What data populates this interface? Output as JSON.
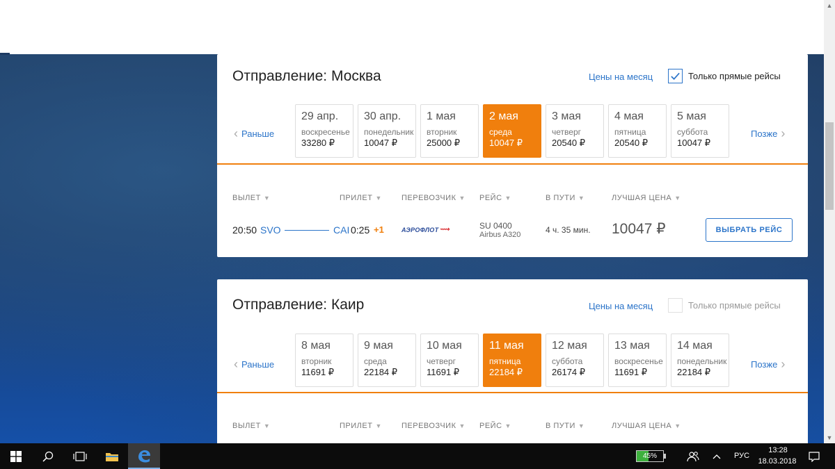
{
  "outbound": {
    "title": "Отправление: Москва",
    "month_link": "Цены на месяц",
    "direct_label": "Только прямые рейсы",
    "direct_checked": true,
    "prev_label": "Раньше",
    "next_label": "Позже",
    "dates": [
      {
        "date": "29 апр.",
        "weekday": "воскресенье",
        "price": "33280 ₽",
        "selected": false
      },
      {
        "date": "30 апр.",
        "weekday": "понедельник",
        "price": "10047 ₽",
        "selected": false
      },
      {
        "date": "1 мая",
        "weekday": "вторник",
        "price": "25000 ₽",
        "selected": false
      },
      {
        "date": "2 мая",
        "weekday": "среда",
        "price": "10047 ₽",
        "selected": true
      },
      {
        "date": "3 мая",
        "weekday": "четверг",
        "price": "20540 ₽",
        "selected": false
      },
      {
        "date": "4 мая",
        "weekday": "пятница",
        "price": "20540 ₽",
        "selected": false
      },
      {
        "date": "5 мая",
        "weekday": "суббота",
        "price": "10047 ₽",
        "selected": false
      }
    ],
    "columns": {
      "departure": "ВЫЛЕТ",
      "arrival": "ПРИЛЕТ",
      "carrier": "ПЕРЕВОЗЧИК",
      "flight": "РЕЙС",
      "duration": "В ПУТИ",
      "best_price": "ЛУЧШАЯ ЦЕНА"
    },
    "flight": {
      "dep_time": "20:50",
      "dep_code": "SVO",
      "arr_code": "CAI",
      "arr_time": "0:25",
      "next_day": "+1",
      "airline": "АЭРОФЛОТ",
      "flight_no": "SU 0400",
      "aircraft": "Airbus A320",
      "duration": "4 ч. 35 мин.",
      "price": "10047 ₽",
      "select_label": "ВЫБРАТЬ РЕЙС"
    }
  },
  "return": {
    "title": "Отправление: Каир",
    "month_link": "Цены на месяц",
    "direct_label": "Только прямые рейсы",
    "direct_checked": false,
    "prev_label": "Раньше",
    "next_label": "Позже",
    "dates": [
      {
        "date": "8 мая",
        "weekday": "вторник",
        "price": "11691 ₽",
        "selected": false
      },
      {
        "date": "9 мая",
        "weekday": "среда",
        "price": "22184 ₽",
        "selected": false
      },
      {
        "date": "10 мая",
        "weekday": "четверг",
        "price": "11691 ₽",
        "selected": false
      },
      {
        "date": "11 мая",
        "weekday": "пятница",
        "price": "22184 ₽",
        "selected": true
      },
      {
        "date": "12 мая",
        "weekday": "суббота",
        "price": "26174 ₽",
        "selected": false
      },
      {
        "date": "13 мая",
        "weekday": "воскресенье",
        "price": "11691 ₽",
        "selected": false
      },
      {
        "date": "14 мая",
        "weekday": "понедельник",
        "price": "22184 ₽",
        "selected": false
      }
    ],
    "columns": {
      "departure": "ВЫЛЕТ",
      "arrival": "ПРИЛЕТ",
      "carrier": "ПЕРЕВОЗЧИК",
      "flight": "РЕЙС",
      "duration": "В ПУТИ",
      "best_price": "ЛУЧШАЯ ЦЕНА"
    }
  },
  "taskbar": {
    "battery": "45%",
    "language": "РУС",
    "time": "13:28",
    "date": "18.03.2018",
    "icons": [
      "windows-start-icon",
      "search-icon",
      "task-view-icon",
      "file-explorer-icon",
      "edge-browser-icon",
      "people-icon",
      "chevron-up-icon",
      "notification-icon"
    ]
  },
  "colors": {
    "accent_orange": "#f07f0d",
    "link_blue": "#2b74c9"
  }
}
